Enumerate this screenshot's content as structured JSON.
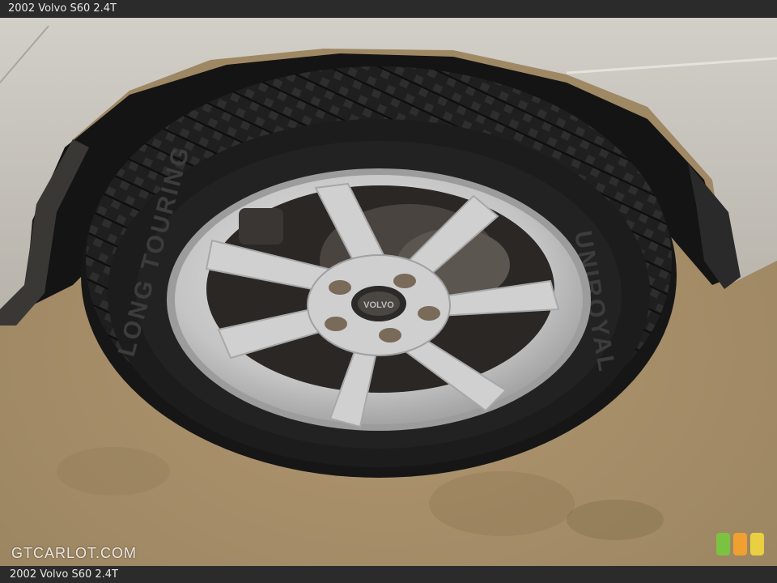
{
  "header": {
    "title": "2002 Volvo S60 2.4T"
  },
  "footer": {
    "caption": "2002 Volvo S60 2.4T"
  },
  "photo": {
    "tire_text_left": "LONG TOURING",
    "tire_text_right": "UNIROYAL",
    "hub_text": "VOLVO"
  },
  "watermark": {
    "text": "GTCARLOT.COM"
  },
  "colors": {
    "bar": "#2b2b2b",
    "floor": "#a88f66",
    "body_panel": "#c9c6bf",
    "tire": "#1c1c1c",
    "rim": "#c5c5c5",
    "rating_green": "#7cc242",
    "rating_orange": "#f0a030",
    "rating_yellow": "#e8d040"
  },
  "icons": [
    "wheel-photo",
    "rating-badge-icon"
  ]
}
